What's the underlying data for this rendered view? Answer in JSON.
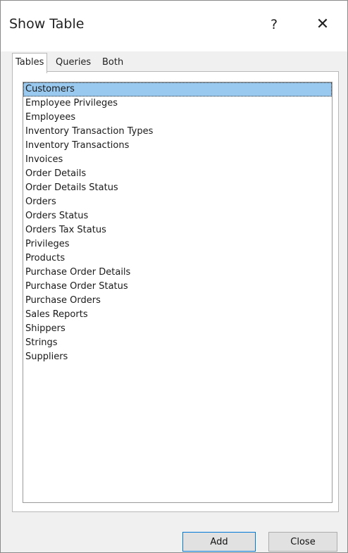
{
  "window": {
    "title": "Show Table",
    "help_label": "?",
    "close_label": "✕"
  },
  "tabs": [
    {
      "label": "Tables",
      "active": true
    },
    {
      "label": "Queries",
      "active": false
    },
    {
      "label": "Both",
      "active": false
    }
  ],
  "tables": {
    "selected_index": 0,
    "items": [
      "Customers",
      "Employee Privileges",
      "Employees",
      "Inventory Transaction Types",
      "Inventory Transactions",
      "Invoices",
      "Order Details",
      "Order Details Status",
      "Orders",
      "Orders Status",
      "Orders Tax Status",
      "Privileges",
      "Products",
      "Purchase Order Details",
      "Purchase Order Status",
      "Purchase Orders",
      "Sales Reports",
      "Shippers",
      "Strings",
      "Suppliers"
    ]
  },
  "buttons": {
    "add_label": "Add",
    "close_label": "Close"
  },
  "colors": {
    "selection": "#99c9ef",
    "default_button_border": "#0078d7"
  }
}
